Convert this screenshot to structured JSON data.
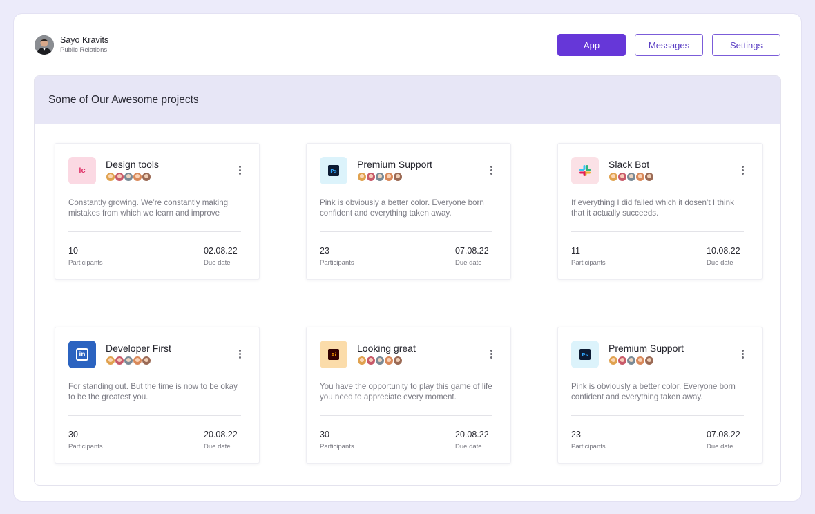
{
  "profile": {
    "name": "Sayo Kravits",
    "role": "Public Relations"
  },
  "nav": {
    "app": "App",
    "messages": "Messages",
    "settings": "Settings"
  },
  "panel": {
    "title": "Some of Our Awesome projects"
  },
  "labels": {
    "participants": "Participants",
    "due_date": "Due date"
  },
  "cards": [
    {
      "title": "Design tools",
      "icon": "invision-icon",
      "icon_text": "Ic",
      "description": "Constantly growing. We’re constantly making mistakes from which we learn and improve",
      "participants": "10",
      "due": "02.08.22"
    },
    {
      "title": "Premium Support",
      "icon": "photoshop-icon",
      "icon_text": "Ps",
      "description": "Pink is obviously a better color. Everyone born confident and everything taken away.",
      "participants": "23",
      "due": "07.08.22"
    },
    {
      "title": "Slack Bot",
      "icon": "slack-icon",
      "icon_text": "",
      "description": "If everything I did failed which it dosen’t I think that it actually succeeds.",
      "participants": "11",
      "due": "10.08.22"
    },
    {
      "title": "Developer First",
      "icon": "linkedin-icon",
      "icon_text": "in",
      "description": "For standing out. But the time is now to be okay to be the greatest you.",
      "participants": "30",
      "due": "20.08.22"
    },
    {
      "title": "Looking great",
      "icon": "illustrator-icon",
      "icon_text": "Ai",
      "description": "You have the opportunity to play this game of life you need to appreciate every moment.",
      "participants": "30",
      "due": "20.08.22"
    },
    {
      "title": "Premium Support",
      "icon": "photoshop-icon",
      "icon_text": "Ps",
      "description": "Pink is obviously a better color. Everyone born confident and everything taken away.",
      "participants": "23",
      "due": "07.08.22"
    }
  ],
  "colors": {
    "accent": "#6637d8",
    "page_bg": "#ecebfa",
    "panel_header": "#e7e6f6"
  }
}
